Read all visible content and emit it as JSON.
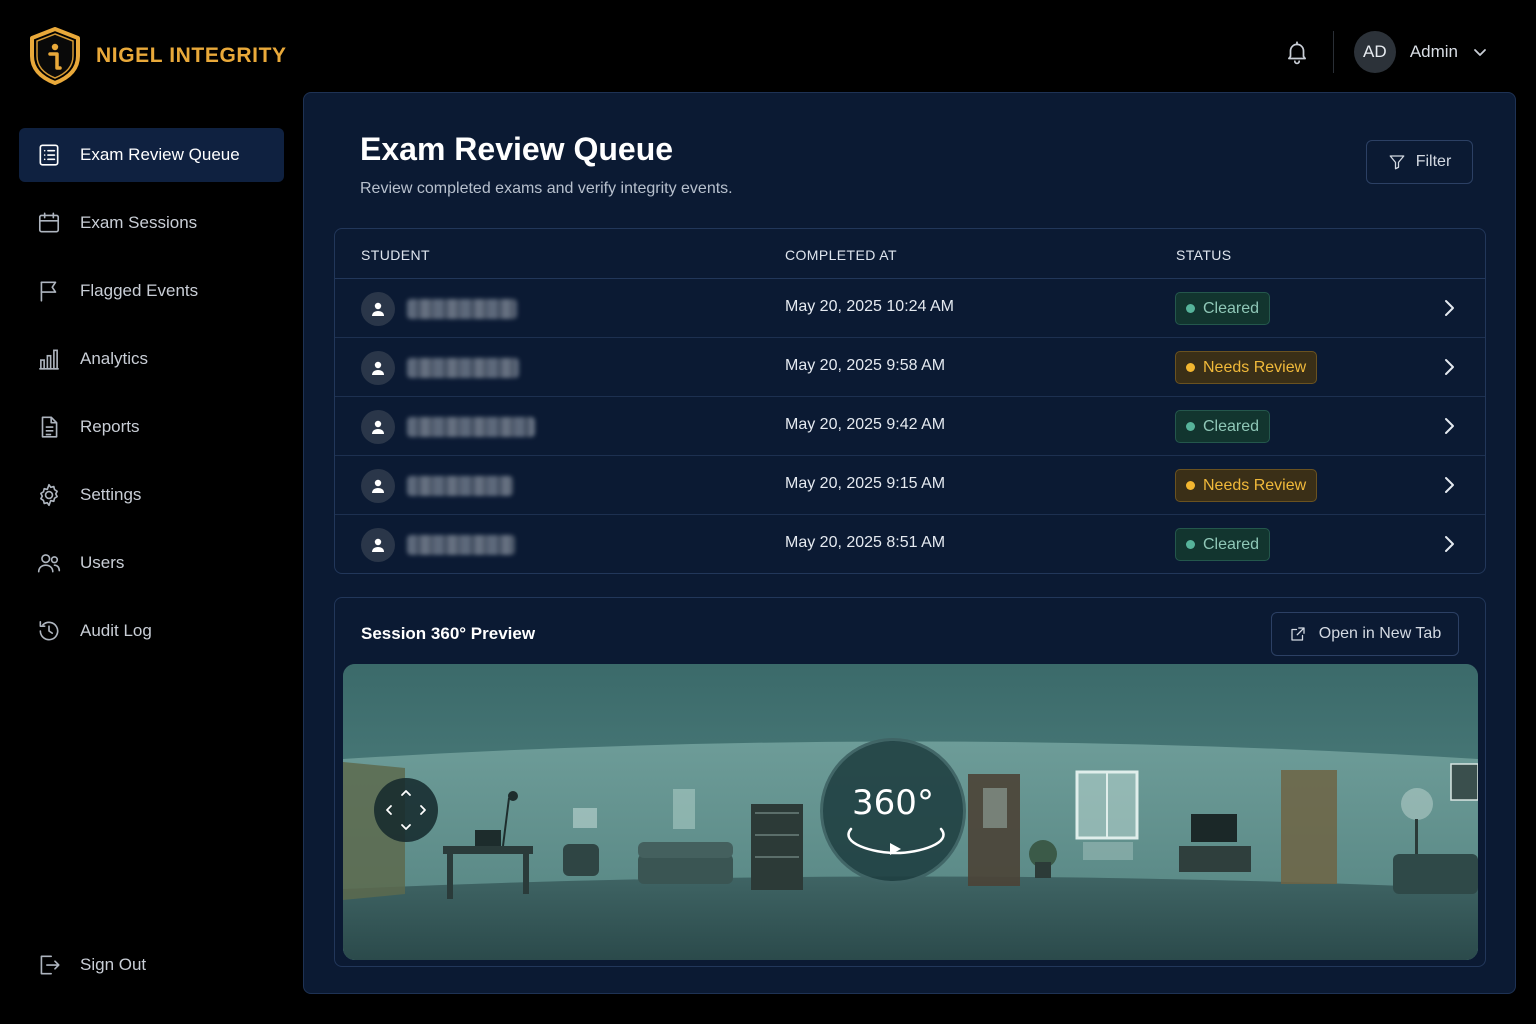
{
  "brand": {
    "name": "NIGEL INTEGRITY",
    "logo_icon": "shield-info-icon",
    "accent": "#e9a93a"
  },
  "header": {
    "notifications_icon": "bell-icon",
    "avatar_initials": "AD",
    "user_name": "Admin",
    "menu_icon": "chevron-down-icon"
  },
  "sidebar": {
    "items": [
      {
        "label": "Exam Review Queue",
        "icon": "clipboard-list-icon",
        "active": true
      },
      {
        "label": "Exam Sessions",
        "icon": "calendar-icon"
      },
      {
        "label": "Flagged Events",
        "icon": "flag-icon"
      },
      {
        "label": "Analytics",
        "icon": "bar-chart-icon"
      },
      {
        "label": "Reports",
        "icon": "document-icon"
      },
      {
        "label": "Settings",
        "icon": "gear-icon"
      },
      {
        "label": "Users",
        "icon": "users-icon"
      },
      {
        "label": "Audit Log",
        "icon": "history-icon"
      }
    ],
    "sign_out": {
      "label": "Sign Out",
      "icon": "sign-out-icon"
    }
  },
  "main": {
    "title": "Exam Review Queue",
    "subtitle": "Review completed exams and verify integrity events.",
    "filter_label": "Filter",
    "table": {
      "columns": [
        "STUDENT",
        "COMPLETED AT",
        "STATUS"
      ],
      "rows": [
        {
          "completed_at": "May 20, 2025 10:24 AM",
          "status": "Cleared",
          "status_kind": "cleared"
        },
        {
          "completed_at": "May 20, 2025 9:58 AM",
          "status": "Needs Review",
          "status_kind": "review"
        },
        {
          "completed_at": "May 20, 2025 9:42 AM",
          "status": "Cleared",
          "status_kind": "cleared"
        },
        {
          "completed_at": "May 20, 2025 9:15 AM",
          "status": "Needs Review",
          "status_kind": "review"
        },
        {
          "completed_at": "May 20, 2025 8:51 AM",
          "status": "Cleared",
          "status_kind": "cleared"
        }
      ]
    },
    "preview": {
      "title": "Session 360° Preview",
      "open_button": "Open in New Tab",
      "badge": "360°"
    }
  },
  "colors": {
    "page_bg": "#000000",
    "panel_bg": "#0b1a33",
    "active_nav_bg": "#0f2140",
    "cleared": "#56b39a",
    "needs_review": "#f2b630"
  }
}
